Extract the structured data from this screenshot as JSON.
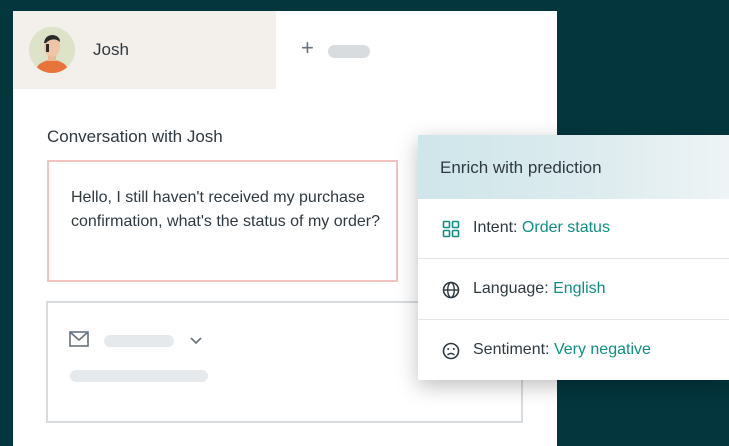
{
  "tab": {
    "name": "Josh",
    "add_symbol": "+"
  },
  "conversation": {
    "title": "Conversation with Josh",
    "message": "Hello, I still haven't received my purchase confirmation, what's the status of my order?"
  },
  "prediction": {
    "title": "Enrich with prediction",
    "rows": [
      {
        "icon": "grid-icon",
        "label": "Intent: ",
        "value": "Order status"
      },
      {
        "icon": "globe-icon",
        "label": "Language: ",
        "value": "English"
      },
      {
        "icon": "sad-face-icon",
        "label": "Sentiment: ",
        "value": "Very negative"
      }
    ]
  },
  "colors": {
    "background": "#03363d",
    "accent": "#108e84",
    "message_border": "#f1c3bd"
  }
}
